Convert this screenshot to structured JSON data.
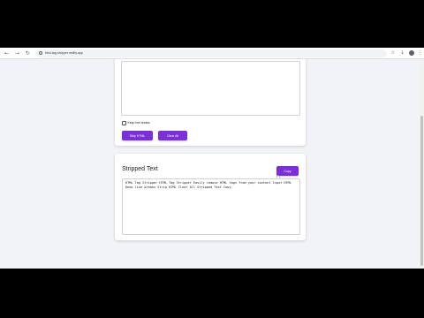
{
  "browser": {
    "back_icon": "arrow-left-icon",
    "forward_icon": "arrow-right-icon",
    "reload_icon": "reload-icon",
    "url": "html-tag-stripper.netlify.app"
  },
  "input_section": {
    "textarea_value": "",
    "checkbox_label": "Keep line breaks",
    "checkbox_checked": false,
    "strip_button_label": "Strip HTML",
    "clear_button_label": "Clear All"
  },
  "output_section": {
    "title": "Stripped Text",
    "copy_button_label": "Copy",
    "output_text": "HTML Tag Stripper HTML Tag Stripper Easily remove HTML tags from your content Input HTML Keep line breaks Strip HTML Clear All Stripped Text Copy"
  },
  "colors": {
    "accent": "#7b2fd6",
    "page_background": "#f2f3f6"
  }
}
